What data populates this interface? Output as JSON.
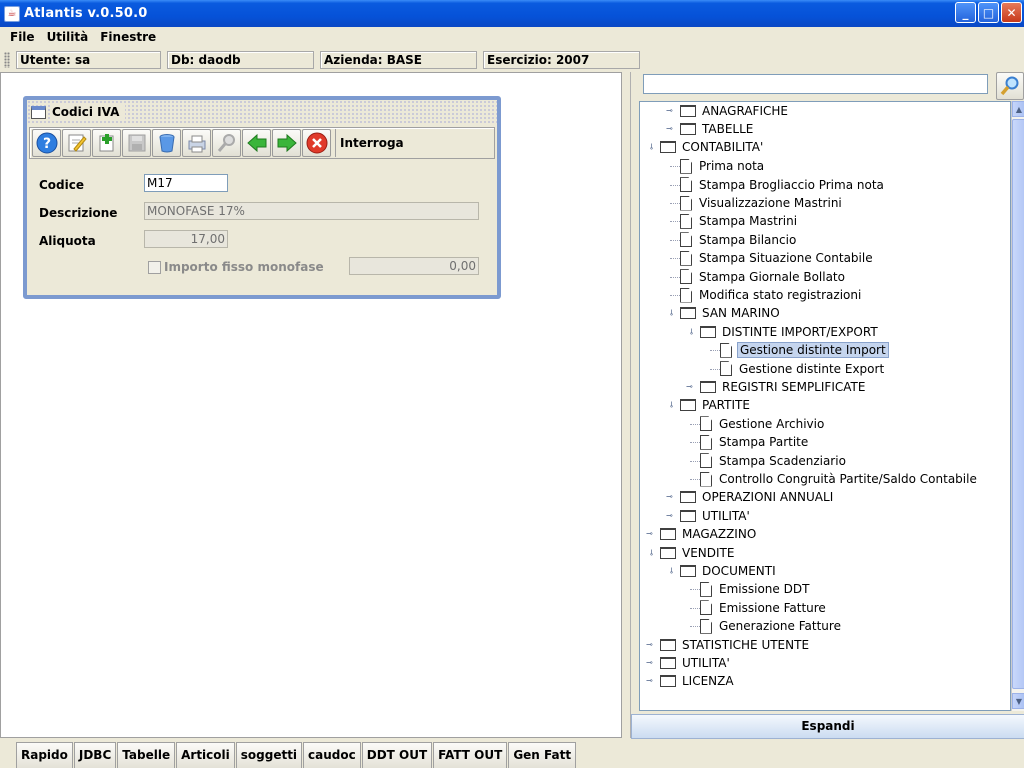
{
  "window": {
    "title": "Atlantis v.0.50.0"
  },
  "menu": [
    "File",
    "Utilità",
    "Finestre"
  ],
  "status": {
    "utente": "Utente: sa",
    "db": "Db: daodb",
    "azienda": "Azienda: BASE",
    "esercizio": "Esercizio: 2007"
  },
  "frame": {
    "title": "Codici IVA",
    "toolbar_label": "Interroga",
    "toolbar_icons": [
      "help-icon",
      "edit-icon",
      "add-icon",
      "save-icon",
      "delete-icon",
      "print-icon",
      "search-icon",
      "previous-icon",
      "next-icon",
      "close-icon"
    ]
  },
  "form": {
    "codice_label": "Codice",
    "codice_value": "M17",
    "descrizione_label": "Descrizione",
    "descrizione_value": "MONOFASE 17%",
    "aliquota_label": "Aliquota",
    "aliquota_value": "17,00",
    "importo_label": "Importo fisso monofase",
    "importo_value": "0,00"
  },
  "tree": {
    "search_placeholder": "",
    "items": [
      {
        "label": "ANAGRAFICHE",
        "type": "folder",
        "level": 1,
        "expanded": false
      },
      {
        "label": "TABELLE",
        "type": "folder",
        "level": 1,
        "expanded": false
      },
      {
        "label": "CONTABILITA'",
        "type": "folder",
        "level": 0,
        "expanded": true
      },
      {
        "label": "Prima nota",
        "type": "leaf",
        "level": 1
      },
      {
        "label": "Stampa Brogliaccio Prima nota",
        "type": "leaf",
        "level": 1
      },
      {
        "label": "Visualizzazione Mastrini",
        "type": "leaf",
        "level": 1
      },
      {
        "label": "Stampa Mastrini",
        "type": "leaf",
        "level": 1
      },
      {
        "label": "Stampa Bilancio",
        "type": "leaf",
        "level": 1
      },
      {
        "label": "Stampa Situazione Contabile",
        "type": "leaf",
        "level": 1
      },
      {
        "label": "Stampa Giornale Bollato",
        "type": "leaf",
        "level": 1
      },
      {
        "label": "Modifica stato registrazioni",
        "type": "leaf",
        "level": 1
      },
      {
        "label": "SAN MARINO",
        "type": "folder",
        "level": 1,
        "expanded": true
      },
      {
        "label": "DISTINTE IMPORT/EXPORT",
        "type": "folder",
        "level": 2,
        "expanded": true
      },
      {
        "label": "Gestione distinte Import",
        "type": "leaf",
        "level": 3,
        "selected": true
      },
      {
        "label": "Gestione distinte Export",
        "type": "leaf",
        "level": 3
      },
      {
        "label": "REGISTRI SEMPLIFICATE",
        "type": "folder",
        "level": 2,
        "expanded": false
      },
      {
        "label": "PARTITE",
        "type": "folder",
        "level": 1,
        "expanded": true
      },
      {
        "label": "Gestione Archivio",
        "type": "leaf",
        "level": 2
      },
      {
        "label": "Stampa Partite",
        "type": "leaf",
        "level": 2
      },
      {
        "label": "Stampa Scadenziario",
        "type": "leaf",
        "level": 2
      },
      {
        "label": "Controllo Congruità Partite/Saldo Contabile",
        "type": "leaf",
        "level": 2
      },
      {
        "label": "OPERAZIONI ANNUALI",
        "type": "folder",
        "level": 1,
        "expanded": false
      },
      {
        "label": "UTILITA'",
        "type": "folder",
        "level": 1,
        "expanded": false
      },
      {
        "label": "MAGAZZINO",
        "type": "folder",
        "level": 0,
        "expanded": false
      },
      {
        "label": "VENDITE",
        "type": "folder",
        "level": 0,
        "expanded": true
      },
      {
        "label": "DOCUMENTI",
        "type": "folder",
        "level": 1,
        "expanded": true
      },
      {
        "label": "Emissione DDT",
        "type": "leaf",
        "level": 2
      },
      {
        "label": "Emissione Fatture",
        "type": "leaf",
        "level": 2
      },
      {
        "label": "Generazione Fatture",
        "type": "leaf",
        "level": 2
      },
      {
        "label": "STATISTICHE UTENTE",
        "type": "folder",
        "level": 0,
        "expanded": false
      },
      {
        "label": "UTILITA'",
        "type": "folder",
        "level": 0,
        "expanded": false
      },
      {
        "label": "LICENZA",
        "type": "folder",
        "level": 0,
        "expanded": false
      }
    ],
    "expand_button": "Espandi"
  },
  "taskbar": [
    "Rapido",
    "JDBC",
    "Tabelle",
    "Articoli",
    "soggetti",
    "caudoc",
    "DDT OUT",
    "FATT OUT",
    "Gen Fatt"
  ],
  "colors": {
    "titlebar": "#0652d8",
    "frame_border": "#7c9ad0",
    "selection": "#c5d5ee"
  }
}
